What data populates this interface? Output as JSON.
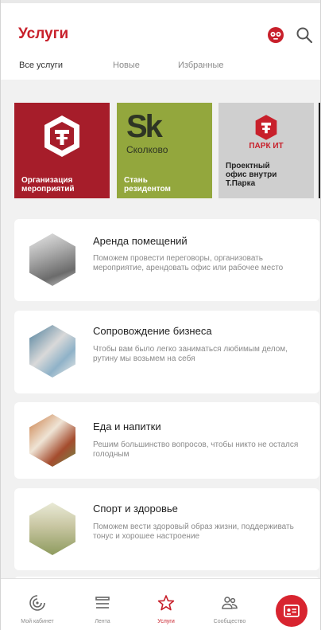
{
  "header": {
    "title": "Услуги",
    "icons": [
      "bot-icon",
      "search-icon"
    ]
  },
  "tabs": [
    {
      "label": "Все услуги",
      "active": true
    },
    {
      "label": "Новые",
      "active": false
    },
    {
      "label": "Избранные",
      "active": false
    }
  ],
  "banners": [
    {
      "label": "Организация\nмероприятий",
      "color": "#a61d2a",
      "icon": "t-logo-icon"
    },
    {
      "label": "Стань\nрезидентом",
      "brand": "Sk",
      "brand_name": "Сколково",
      "color": "#93a73d"
    },
    {
      "label": "Проектный\nофис внутри\nТ.Парка",
      "brand_name": "ПАРК ИТ",
      "color": "#cfcfcf",
      "icon": "t-logo-icon"
    }
  ],
  "services": [
    {
      "title": "Аренда помещений",
      "description": "Поможем провести переговоры, организовать мероприятие, арендовать офис или рабочее место"
    },
    {
      "title": "Сопровождение бизнеса",
      "description": "Чтобы вам было легко заниматься любимым делом, рутину мы возьмем на себя"
    },
    {
      "title": "Еда и напитки",
      "description": "Решим большинство вопросов, чтобы никто не остался голодным"
    },
    {
      "title": "Спорт и здоровье",
      "description": "Поможем вести здоровый образ жизни, поддерживать тонус и хорошее настроение"
    }
  ],
  "bottom_nav": [
    {
      "label": "Мой кабинет",
      "icon": "cabinet-icon",
      "active": false
    },
    {
      "label": "Лента",
      "icon": "feed-icon",
      "active": false
    },
    {
      "label": "Услуги",
      "icon": "star-icon",
      "active": true
    },
    {
      "label": "Сообщество",
      "icon": "community-icon",
      "active": false
    }
  ],
  "fab_icon": "id-card-icon",
  "colors": {
    "accent": "#c8202b",
    "background": "#f1f1f1"
  }
}
